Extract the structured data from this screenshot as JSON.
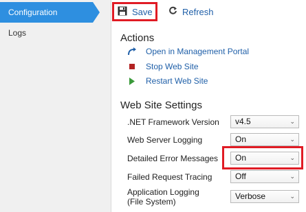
{
  "sidebar": {
    "items": [
      {
        "label": "Configuration",
        "active": true
      },
      {
        "label": "Logs",
        "active": false
      }
    ]
  },
  "toolbar": {
    "save_label": "Save",
    "refresh_label": "Refresh"
  },
  "actions": {
    "title": "Actions",
    "items": [
      {
        "label": "Open in Management Portal",
        "icon": "redirect-arrow-icon"
      },
      {
        "label": "Stop Web Site",
        "icon": "stop-icon"
      },
      {
        "label": "Restart Web Site",
        "icon": "play-icon"
      }
    ]
  },
  "settings": {
    "title": "Web Site Settings",
    "rows": [
      {
        "label": ".NET Framework Version",
        "value": "v4.5"
      },
      {
        "label": "Web Server Logging",
        "value": "On"
      },
      {
        "label": "Detailed Error Messages",
        "value": "On"
      },
      {
        "label": "Failed Request Tracing",
        "value": "Off"
      },
      {
        "label": "Application Logging",
        "label2": "(File System)",
        "value": "Verbose"
      }
    ]
  },
  "colors": {
    "accent": "#2e8fe0",
    "link": "#1f5fa8",
    "highlight": "#e01b24",
    "stop": "#b22222",
    "play": "#3a9a3a"
  }
}
